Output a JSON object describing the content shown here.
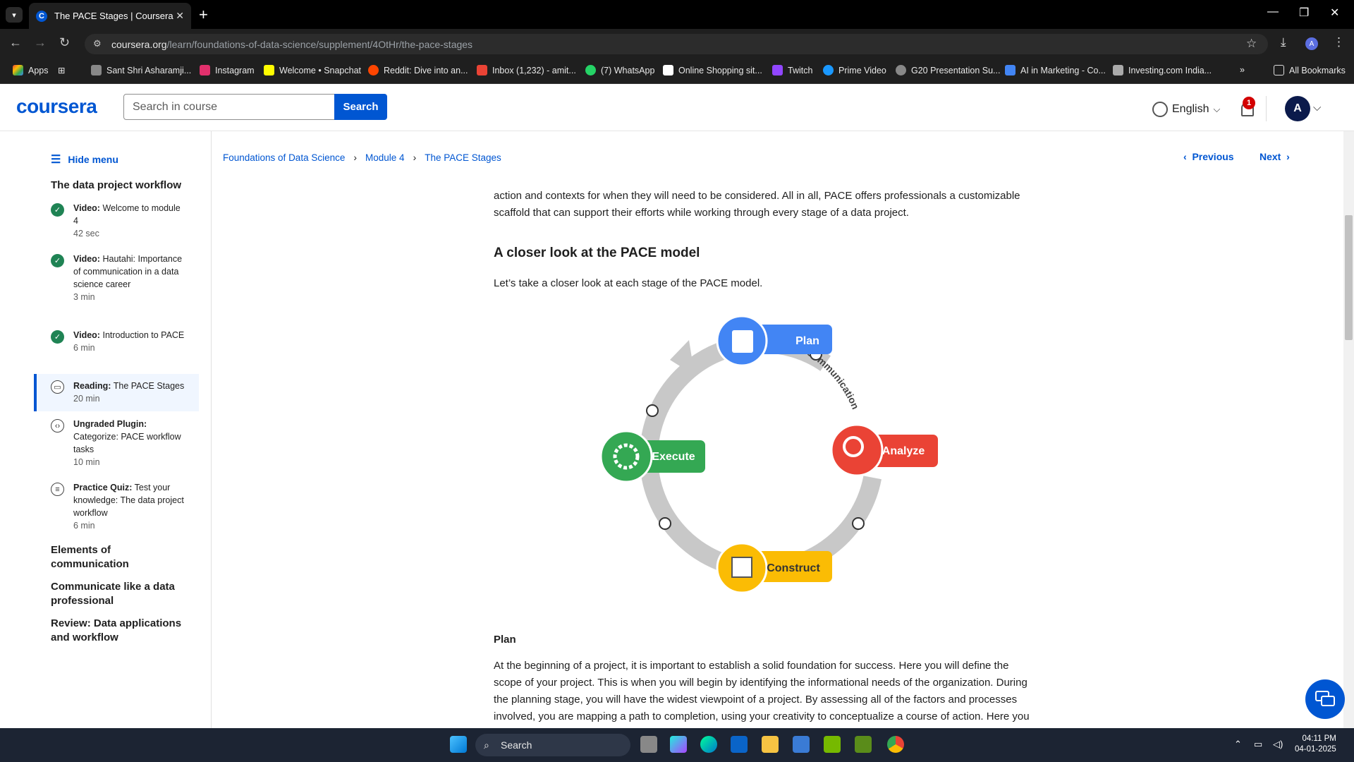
{
  "browser": {
    "tab_title": "The PACE Stages | Coursera",
    "tab_favicon": "C",
    "new_tab": "+",
    "url_domain": "coursera.org",
    "url_path": "/learn/foundations-of-data-science/supplement/4OtHr/the-pace-stages",
    "profile_initial": "A",
    "bookmarks": [
      "Apps",
      "Sant Shri Asharamji...",
      "Instagram",
      "Welcome • Snapchat",
      "Reddit: Dive into an...",
      "Inbox (1,232) - amit...",
      "(7) WhatsApp",
      "Online Shopping sit...",
      "Twitch",
      "Prime Video",
      "G20 Presentation Su...",
      "AI in Marketing - Co...",
      "Investing.com India..."
    ],
    "more_bookmarks": "»",
    "all_bookmarks": "All Bookmarks"
  },
  "header": {
    "logo": "coursera",
    "search_placeholder": "Search in course",
    "search_button": "Search",
    "language": "English",
    "notification_count": "1",
    "avatar_initial": "A"
  },
  "sidebar": {
    "hide_menu": "Hide menu",
    "section_title": "The data project workflow",
    "items": [
      {
        "type": "Video:",
        "title": "Welcome to module 4",
        "duration": "42 sec"
      },
      {
        "type": "Video:",
        "title": "Hautahi: Importance of communication in a data science career",
        "duration": "3 min"
      },
      {
        "type": "Video:",
        "title": "Introduction to PACE",
        "duration": "6 min"
      },
      {
        "type": "Reading:",
        "title": "The PACE Stages",
        "duration": "20 min"
      },
      {
        "type": "Ungraded Plugin:",
        "title": "Categorize: PACE workflow tasks",
        "duration": "10 min"
      },
      {
        "type": "Practice Quiz:",
        "title": "Test your knowledge: The data project workflow",
        "duration": "6 min"
      }
    ],
    "other_sections": [
      "Elements of communication",
      "Communicate like a data professional",
      "Review: Data applications and workflow"
    ]
  },
  "breadcrumb": [
    "Foundations of Data Science",
    "Module 4",
    "The PACE Stages"
  ],
  "nav": {
    "previous": "Previous",
    "next": "Next"
  },
  "content": {
    "intro_para": "action and contexts for when they will need to be considered. All in all, PACE offers professionals a customizable scaffold that can support their efforts while working through every stage of a data project.",
    "heading": "A closer look at the PACE model",
    "lead": "Let’s take a closer look at each stage of the PACE model.",
    "plan_heading": "Plan",
    "plan_para": "At the beginning of a project, it is important to establish a solid foundation for success. Here you will define the scope of your project. This is when you will begin by identifying the informational needs of the organization. During the planning stage, you will have the widest viewpoint of a project. By assessing all of the factors and processes involved, you are mapping a path to completion, using your creativity to conceptualize a course of action. Here you"
  },
  "diagram": {
    "stages": [
      "Plan",
      "Analyze",
      "Construct",
      "Execute"
    ],
    "arc_label": "Communication",
    "colors": {
      "plan": "#4285f4",
      "analyze": "#ea4335",
      "construct": "#fbbc04",
      "execute": "#34a853",
      "ring": "#c8c8c8"
    }
  },
  "taskbar": {
    "search": "Search",
    "time": "04:11 PM",
    "date": "04-01-2025"
  },
  "colors": {
    "brand": "#0056d2",
    "success": "#1f8354"
  }
}
